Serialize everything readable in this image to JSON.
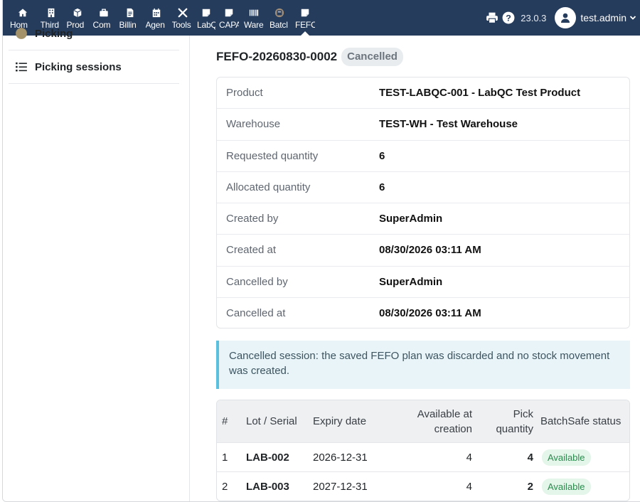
{
  "topbar": {
    "menu": [
      {
        "label": "Hom",
        "icon": "home-icon"
      },
      {
        "label": "Third",
        "icon": "building-icon"
      },
      {
        "label": "Prod",
        "icon": "cube-icon"
      },
      {
        "label": "Com",
        "icon": "briefcase-icon"
      },
      {
        "label": "Billin",
        "icon": "invoice-icon"
      },
      {
        "label": "Agen",
        "icon": "calendar-icon"
      },
      {
        "label": "Tools",
        "icon": "tools-icon"
      },
      {
        "label": "LabQ",
        "icon": "note-icon"
      },
      {
        "label": "CAPA",
        "icon": "note-icon"
      },
      {
        "label": "Ware",
        "icon": "barcode-icon"
      },
      {
        "label": "Batcl",
        "icon": "batch-icon"
      },
      {
        "label": "FEFO",
        "icon": "note-icon"
      }
    ],
    "version": "23.0.3",
    "username": "test.admin",
    "bar_color": "#263c5c"
  },
  "sidebar": {
    "partial_item": "Picking",
    "item": "Picking sessions"
  },
  "session": {
    "ref": "FEFO-20260830-0002",
    "status": "Cancelled",
    "fields": [
      {
        "label": "Product",
        "value": "TEST-LABQC-001 - LabQC Test Product"
      },
      {
        "label": "Warehouse",
        "value": "TEST-WH - Test Warehouse"
      },
      {
        "label": "Requested quantity",
        "value": "6"
      },
      {
        "label": "Allocated quantity",
        "value": "6"
      },
      {
        "label": "Created by",
        "value": "SuperAdmin"
      },
      {
        "label": "Created at",
        "value": "08/30/2026 03:11 AM"
      },
      {
        "label": "Cancelled by",
        "value": "SuperAdmin"
      },
      {
        "label": "Cancelled at",
        "value": "08/30/2026 03:11 AM"
      }
    ]
  },
  "alert": {
    "text": "Cancelled session: the saved FEFO plan was discarded and no stock movement was created."
  },
  "lots_table": {
    "headers": {
      "num": "#",
      "lot": "Lot / Serial",
      "expiry": "Expiry date",
      "available_line1": "Available at",
      "available_line2": "creation",
      "pick_line1": "Pick",
      "pick_line2": "quantity",
      "status": "BatchSafe status"
    },
    "rows": [
      {
        "num": "1",
        "lot": "LAB-002",
        "expiry": "2026-12-31",
        "available": "4",
        "pick": "4",
        "status": "Available"
      },
      {
        "num": "2",
        "lot": "LAB-003",
        "expiry": "2027-12-31",
        "available": "4",
        "pick": "2",
        "status": "Available"
      }
    ]
  }
}
